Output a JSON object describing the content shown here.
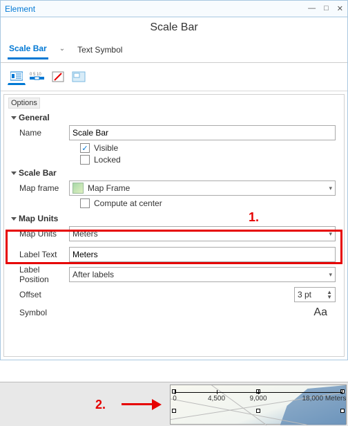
{
  "window": {
    "title": "Element",
    "heading": "Scale Bar"
  },
  "tabs": {
    "scaleBar": "Scale Bar",
    "textSymbol": "Text Symbol"
  },
  "optionsLabel": "Options",
  "groups": {
    "general": "General",
    "scaleBar": "Scale Bar",
    "mapUnits": "Map Units"
  },
  "fields": {
    "nameLabel": "Name",
    "nameValue": "Scale Bar",
    "visibleLabel": "Visible",
    "lockedLabel": "Locked",
    "mapFrameLabel": "Map frame",
    "mapFrameValue": "Map Frame",
    "computeCenterLabel": "Compute at center",
    "mapUnitsLabel": "Map Units",
    "mapUnitsValue": "Meters",
    "labelTextLabel": "Label Text",
    "labelTextValue": "Meters",
    "labelPositionLabel": "Label Position",
    "labelPositionValue": "After labels",
    "offsetLabel": "Offset",
    "offsetValue": "3 pt",
    "symbolLabel": "Symbol",
    "symbolValue": "Aa"
  },
  "annotations": {
    "one": "1.",
    "two": "2."
  },
  "scalebarPreview": {
    "t1": "0",
    "t2": "4,500",
    "t3": "9,000",
    "t4": "18,000 Meters"
  },
  "checks": {
    "visible": true,
    "locked": false,
    "computeCenter": false
  }
}
